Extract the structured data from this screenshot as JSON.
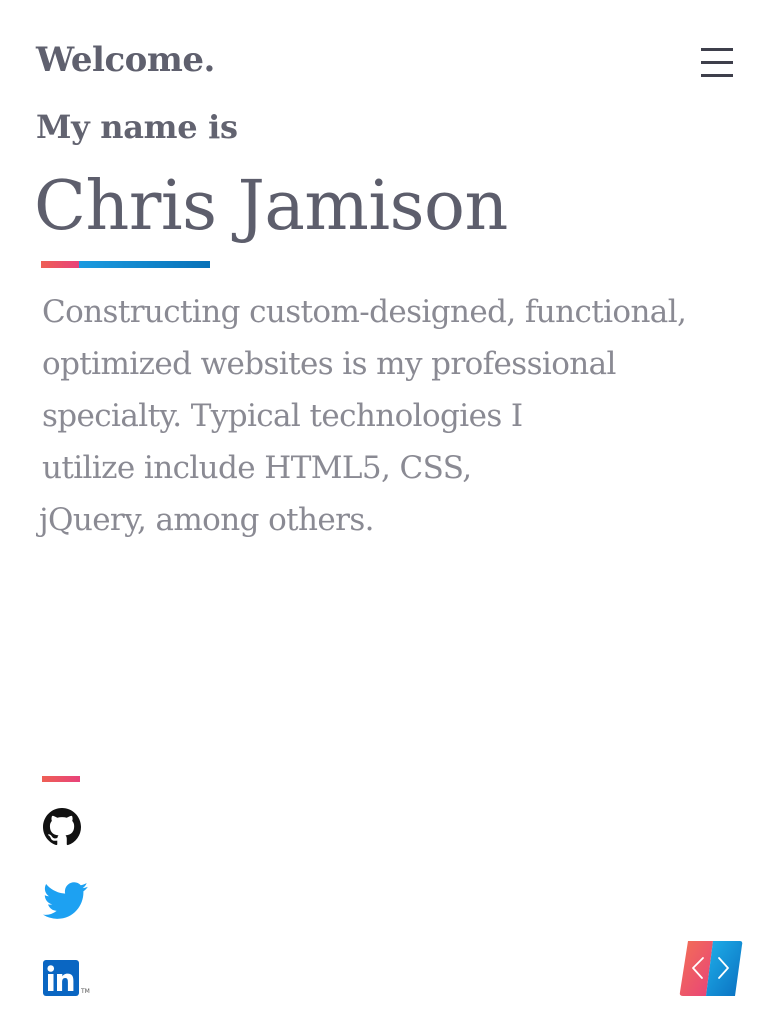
{
  "header": {
    "welcome": "Welcome.",
    "menu_icon": "hamburger-menu-icon"
  },
  "hero": {
    "intro": "My name is",
    "name": "Chris Jamison",
    "bio_lines": [
      "Constructing custom-designed, functional,",
      "optimized websites is my professional",
      "specialty. Typical technologies I",
      "utilize include HTML5, CSS,",
      "jQuery, among others."
    ]
  },
  "social": {
    "items": [
      {
        "name": "GitHub",
        "icon": "github-icon"
      },
      {
        "name": "Twitter",
        "icon": "twitter-icon"
      },
      {
        "name": "LinkedIn",
        "icon": "linkedin-icon",
        "mark": "in",
        "tm": "TM"
      }
    ]
  },
  "nav": {
    "icon": "prev-next-arrows-icon"
  },
  "colors": {
    "text_dark": "#5d5e6c",
    "text_light": "#8a8a93",
    "accent_red": "#e8427a",
    "accent_orange": "#ee5f55",
    "accent_blue": "#0871b8",
    "twitter_blue": "#1da1f2",
    "linkedin_blue": "#0a66c2",
    "github_black": "#111111"
  }
}
